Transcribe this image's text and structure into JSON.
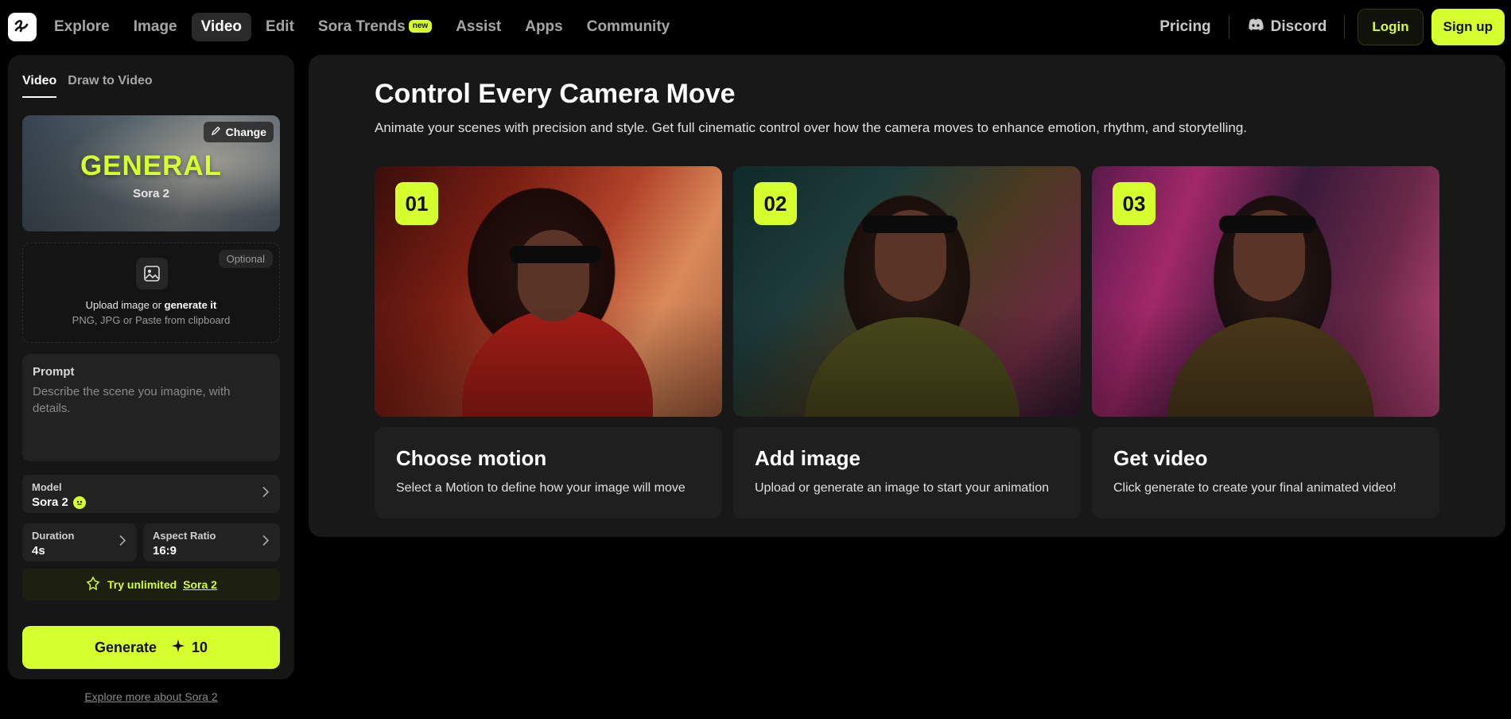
{
  "nav": {
    "items": [
      {
        "label": "Explore"
      },
      {
        "label": "Image"
      },
      {
        "label": "Video"
      },
      {
        "label": "Edit"
      },
      {
        "label": "Sora Trends",
        "badge": "new"
      },
      {
        "label": "Assist"
      },
      {
        "label": "Apps"
      },
      {
        "label": "Community"
      }
    ],
    "active": "Video",
    "pricing": "Pricing",
    "discord": "Discord",
    "login": "Login",
    "signup": "Sign up"
  },
  "left_panel": {
    "tabs": [
      "Video",
      "Draw to Video"
    ],
    "active_tab": "Video",
    "model_card": {
      "title": "GENERAL",
      "subtitle": "Sora 2",
      "change_label": "Change"
    },
    "upload": {
      "optional_label": "Optional",
      "line1_prefix": "Upload image or",
      "line1_link": "generate it",
      "line2": "PNG, JPG or Paste from clipboard"
    },
    "prompt": {
      "label": "Prompt",
      "placeholder": "Describe the scene you imagine, with details."
    },
    "model": {
      "label": "Model",
      "value": "Sora 2"
    },
    "duration": {
      "label": "Duration",
      "value": "4s"
    },
    "aspect_ratio": {
      "label": "Aspect Ratio",
      "value": "16:9"
    },
    "try_banner": {
      "prefix": "Try unlimited",
      "link": "Sora 2"
    },
    "generate": {
      "label": "Generate",
      "cost": "10"
    },
    "explore_link": "Explore more about Sora 2"
  },
  "main": {
    "title": "Control Every Camera Move",
    "description": "Animate your scenes with precision and style. Get full cinematic control over how the camera moves to enhance emotion, rhythm, and storytelling.",
    "steps": [
      {
        "num": "01",
        "title": "Choose motion",
        "desc": "Select a Motion to define how your image will move"
      },
      {
        "num": "02",
        "title": "Add image",
        "desc": "Upload or generate an image to start your animation"
      },
      {
        "num": "03",
        "title": "Get video",
        "desc": "Click generate to create your final animated video!"
      }
    ]
  },
  "colors": {
    "accent": "#d6ff2e",
    "background": "#000000",
    "panel": "#161616"
  }
}
